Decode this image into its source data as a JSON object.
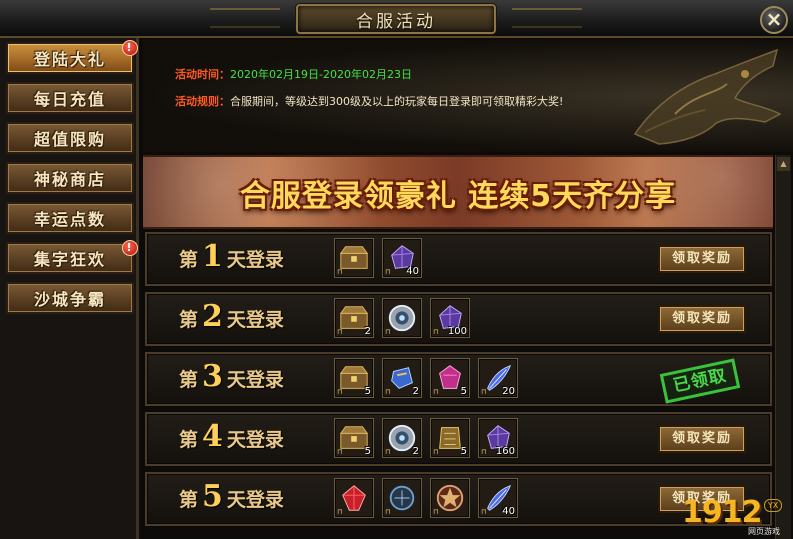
{
  "window": {
    "title": "合服活动",
    "close_label": "×"
  },
  "sidebar": {
    "items": [
      {
        "label": "登陆大礼",
        "active": true,
        "alert": true
      },
      {
        "label": "每日充值",
        "active": false,
        "alert": false
      },
      {
        "label": "超值限购",
        "active": false,
        "alert": false
      },
      {
        "label": "神秘商店",
        "active": false,
        "alert": false
      },
      {
        "label": "幸运点数",
        "active": false,
        "alert": false
      },
      {
        "label": "集字狂欢",
        "active": false,
        "alert": true
      },
      {
        "label": "沙城争霸",
        "active": false,
        "alert": false
      }
    ],
    "alert_mark": "!"
  },
  "info": {
    "time_label": "活动时间：",
    "time_value": "2020年02月19日-2020年02月23日",
    "rule_label": "活动规则：",
    "rule_value": "合服期间，等级达到300级及以上的玩家每日登录即可领取精彩大奖!"
  },
  "banner": {
    "text": "合服登录领豪礼 连续5天齐分享"
  },
  "rows": [
    {
      "prefix": "第",
      "num": "1",
      "suffix": "天登录",
      "button": "领取奖励",
      "claimed": false,
      "items": [
        {
          "icon": "treasure-chest-icon",
          "qty": ""
        },
        {
          "icon": "purple-gem-icon",
          "qty": "40"
        }
      ]
    },
    {
      "prefix": "第",
      "num": "2",
      "suffix": "天登录",
      "button": "领取奖励",
      "claimed": false,
      "items": [
        {
          "icon": "treasure-chest-icon",
          "qty": "2"
        },
        {
          "icon": "silver-medallion-icon",
          "qty": ""
        },
        {
          "icon": "purple-gem-icon",
          "qty": "100"
        }
      ]
    },
    {
      "prefix": "第",
      "num": "3",
      "suffix": "天登录",
      "button": "已领取",
      "claimed": true,
      "items": [
        {
          "icon": "treasure-chest-icon",
          "qty": "5"
        },
        {
          "icon": "blue-crystal-icon",
          "qty": "2"
        },
        {
          "icon": "pink-gem-icon",
          "qty": "5"
        },
        {
          "icon": "blue-feather-icon",
          "qty": "20"
        }
      ]
    },
    {
      "prefix": "第",
      "num": "4",
      "suffix": "天登录",
      "button": "领取奖励",
      "claimed": false,
      "items": [
        {
          "icon": "treasure-chest-icon",
          "qty": "5"
        },
        {
          "icon": "silver-medallion-icon",
          "qty": "2"
        },
        {
          "icon": "gold-token-icon",
          "qty": "5"
        },
        {
          "icon": "purple-gem-icon",
          "qty": "160"
        }
      ]
    },
    {
      "prefix": "第",
      "num": "5",
      "suffix": "天登录",
      "button": "领取奖励",
      "claimed": false,
      "items": [
        {
          "icon": "red-gem-icon",
          "qty": ""
        },
        {
          "icon": "dark-armor-icon",
          "qty": ""
        },
        {
          "icon": "star-rune-icon",
          "qty": ""
        },
        {
          "icon": "blue-feather-icon",
          "qty": "40"
        }
      ]
    }
  ],
  "scrollbar": {
    "up_arrow": "▲"
  },
  "watermark": {
    "number": "1912",
    "yx": "YX",
    "sub": "网页游戏"
  },
  "colors": {
    "accent": "#ffd95a",
    "label_red": "#ff5a1e",
    "date_green": "#46e04a",
    "claimed_green": "#3ac23a"
  }
}
